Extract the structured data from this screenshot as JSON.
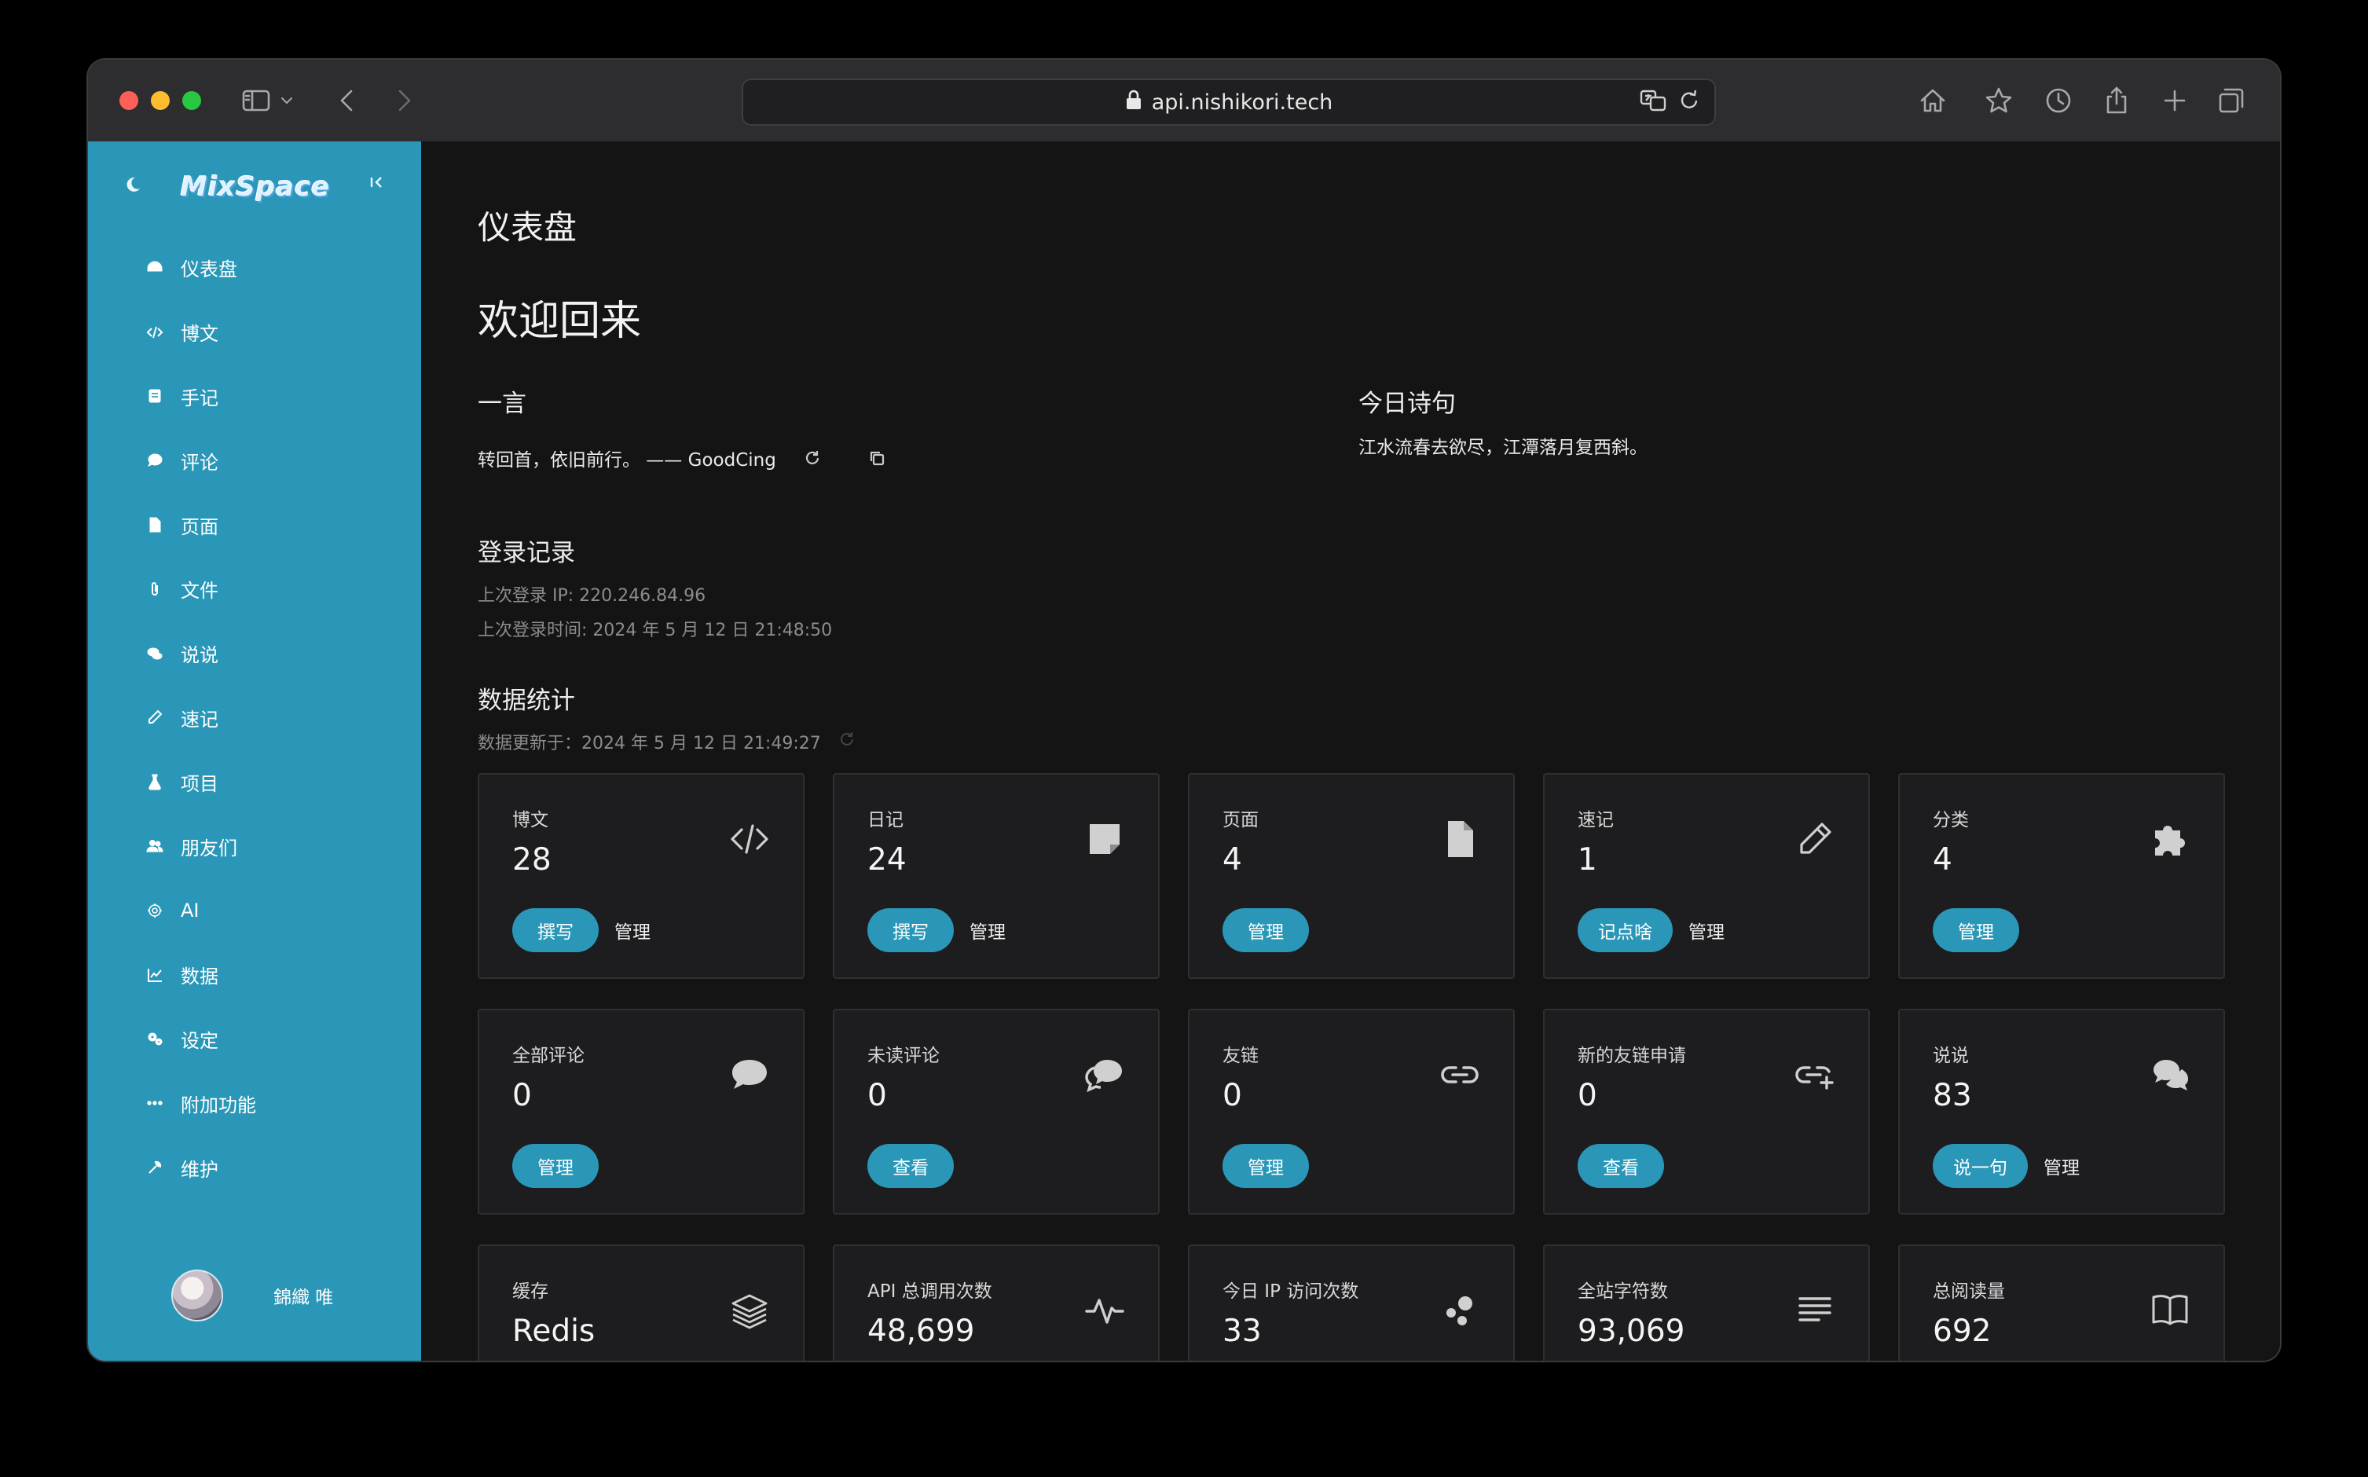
{
  "browser": {
    "url": "api.nishikori.tech"
  },
  "sidebar": {
    "logo_text": "MixSpace",
    "items": [
      {
        "label": "仪表盘",
        "icon": "dashboard-icon"
      },
      {
        "label": "博文",
        "icon": "code-icon"
      },
      {
        "label": "手记",
        "icon": "notebook-icon"
      },
      {
        "label": "评论",
        "icon": "comment-icon"
      },
      {
        "label": "页面",
        "icon": "file-icon"
      },
      {
        "label": "文件",
        "icon": "paperclip-icon"
      },
      {
        "label": "说说",
        "icon": "chat-icon"
      },
      {
        "label": "速记",
        "icon": "pencil-icon"
      },
      {
        "label": "项目",
        "icon": "flask-icon"
      },
      {
        "label": "朋友们",
        "icon": "users-icon"
      },
      {
        "label": "AI",
        "icon": "ai-icon"
      },
      {
        "label": "数据",
        "icon": "chart-icon"
      },
      {
        "label": "设定",
        "icon": "gears-icon"
      },
      {
        "label": "附加功能",
        "icon": "more-icon"
      },
      {
        "label": "维护",
        "icon": "wrench-icon"
      }
    ],
    "user": {
      "name": "錦織 唯"
    }
  },
  "main": {
    "page_title": "仪表盘",
    "welcome": "欢迎回来",
    "hitokoto": {
      "title": "一言",
      "text": "转回首，依旧前行。 —— GoodCing"
    },
    "poem": {
      "title": "今日诗句",
      "text": "江水流春去欲尽，江潭落月复西斜。"
    },
    "login": {
      "title": "登录记录",
      "ip": "上次登录 IP: 220.246.84.96",
      "time": "上次登录时间: 2024 年 5 月 12 日 21:48:50"
    },
    "stats": {
      "title": "数据统计",
      "updated": "数据更新于：2024 年 5 月 12 日 21:49:27"
    },
    "cards": [
      {
        "label": "博文",
        "value": "28",
        "icon": "code-icon",
        "actions": [
          {
            "type": "pill",
            "label": "撰写"
          },
          {
            "type": "link",
            "label": "管理"
          }
        ]
      },
      {
        "label": "日记",
        "value": "24",
        "icon": "sticky-note-icon",
        "actions": [
          {
            "type": "pill",
            "label": "撰写"
          },
          {
            "type": "link",
            "label": "管理"
          }
        ]
      },
      {
        "label": "页面",
        "value": "4",
        "icon": "file-icon",
        "actions": [
          {
            "type": "pill",
            "label": "管理"
          }
        ]
      },
      {
        "label": "速记",
        "value": "1",
        "icon": "pencil-icon",
        "actions": [
          {
            "type": "pill",
            "label": "记点啥"
          },
          {
            "type": "link",
            "label": "管理"
          }
        ]
      },
      {
        "label": "分类",
        "value": "4",
        "icon": "puzzle-icon",
        "actions": [
          {
            "type": "pill",
            "label": "管理"
          }
        ]
      },
      {
        "label": "全部评论",
        "value": "0",
        "icon": "comment-icon",
        "actions": [
          {
            "type": "pill",
            "label": "管理"
          }
        ]
      },
      {
        "label": "未读评论",
        "value": "0",
        "icon": "comment-dots-icon",
        "actions": [
          {
            "type": "pill",
            "label": "查看"
          }
        ]
      },
      {
        "label": "友链",
        "value": "0",
        "icon": "link-icon",
        "actions": [
          {
            "type": "pill",
            "label": "管理"
          }
        ]
      },
      {
        "label": "新的友链申请",
        "value": "0",
        "icon": "link-plus-icon",
        "actions": [
          {
            "type": "pill",
            "label": "查看"
          }
        ]
      },
      {
        "label": "说说",
        "value": "83",
        "icon": "chat-icon",
        "actions": [
          {
            "type": "pill",
            "label": "说一句"
          },
          {
            "type": "link",
            "label": "管理"
          }
        ]
      },
      {
        "label": "缓存",
        "value": "Redis",
        "icon": "layers-icon",
        "actions": []
      },
      {
        "label": "API 总调用次数",
        "value": "48,699",
        "icon": "activity-icon",
        "actions": []
      },
      {
        "label": "今日 IP 访问次数",
        "value": "33",
        "icon": "bubbles-icon",
        "actions": []
      },
      {
        "label": "全站字符数",
        "value": "93,069",
        "icon": "text-lines-icon",
        "actions": []
      },
      {
        "label": "总阅读量",
        "value": "692",
        "icon": "book-icon",
        "actions": []
      }
    ]
  },
  "colors": {
    "accent": "#2a97b8",
    "card_bg": "#1d1d1f",
    "page_bg": "#141415"
  }
}
